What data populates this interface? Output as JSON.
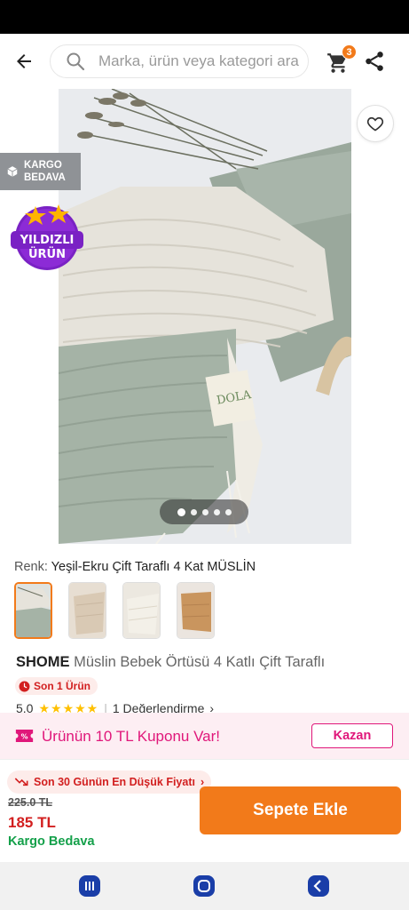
{
  "header": {
    "search_placeholder": "Marka, ürün veya kategori ara",
    "cart_count": "3",
    "back_icon": "arrow-left-icon",
    "search_icon": "search-icon",
    "cart_icon": "cart-icon",
    "share_icon": "share-icon"
  },
  "gallery": {
    "cargo_badge": "KARGO\nBEDAVA",
    "cargo_line1": "KARGO",
    "cargo_line2": "BEDAVA",
    "star_badge_line1": "YILDIZLI",
    "star_badge_line2": "ÜRÜN",
    "label_brand": "DOLA",
    "slide_count": 5,
    "active_slide": 1
  },
  "product": {
    "color_label": "Renk:",
    "color_value": "Yeşil-Ekru Çift Taraflı 4 Kat MÜSLİN",
    "brand": "SHOME",
    "name": "Müslin Bebek Örtüsü 4 Katlı Çift Taraflı",
    "last_badge": "Son 1 Ürün",
    "rating": "5.0",
    "stars": "★★★★★",
    "reviews": "1 Değerlendirme",
    "reviews_chevron": "›"
  },
  "coupon": {
    "text": "Ürünün 10 TL Kuponu Var!",
    "button": "Kazan"
  },
  "purchase": {
    "lowest_badge": "Son 30 Günün En Düşük Fiyatı",
    "badge_chevron": "›",
    "old_price": "225.0 TL",
    "new_price": "185 TL",
    "free_cargo": "Kargo Bedava",
    "add_to_cart": "Sepete Ekle"
  },
  "colors": {
    "brand_orange": "#f27a1a",
    "coupon_pink": "#e0177a",
    "price_red": "#d21f1f",
    "cargo_green": "#14a04a"
  }
}
